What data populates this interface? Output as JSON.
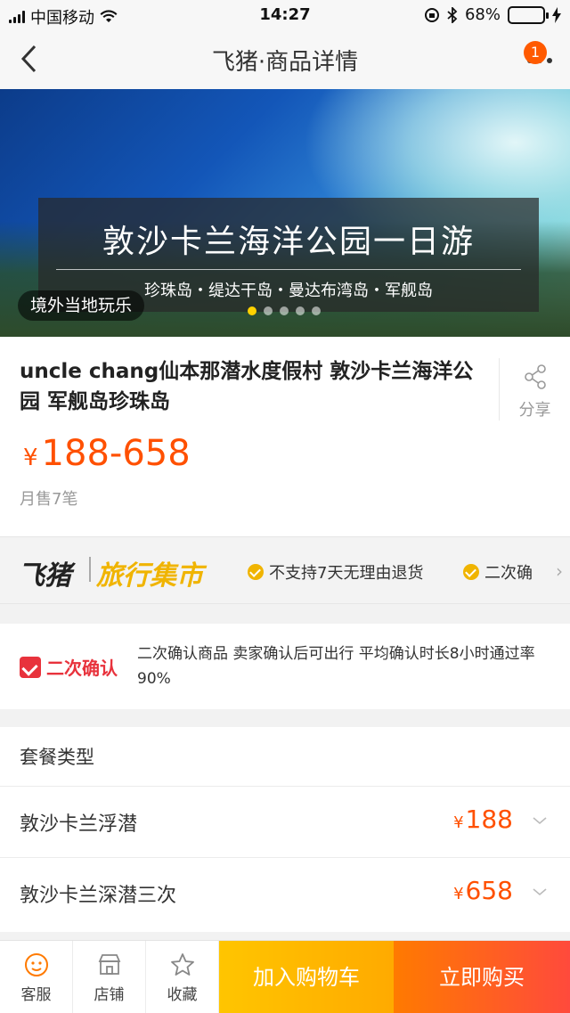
{
  "status_bar": {
    "carrier": "中国移动",
    "time": "14:27",
    "battery": "68%",
    "battery_level": 0.68
  },
  "nav": {
    "title": "飞猪·商品详情",
    "badge": "1"
  },
  "banner": {
    "title": "敦沙卡兰海洋公园一日游",
    "subtitle": "珍珠岛・缇达干岛・曼达布湾岛・军舰岛",
    "tag": "境外当地玩乐",
    "slide_count": 5,
    "active_slide": 1
  },
  "product": {
    "name": "uncle chang仙本那潜水度假村 敦沙卡兰海洋公园 军舰岛珍珠岛",
    "share_label": "分享",
    "currency": "¥",
    "price_range": "188-658",
    "sold": "月售7笔"
  },
  "market": {
    "logo_left": "飞猪",
    "logo_right": "旅行集市",
    "feature1": "不支持7天无理由退货",
    "feature2": "二次确"
  },
  "confirm": {
    "label": "二次确认",
    "text": "二次确认商品 卖家确认后可出行 平均确认时长8小时通过率90%"
  },
  "package": {
    "header": "套餐类型",
    "options": [
      {
        "name": "敦沙卡兰浮潜",
        "currency": "¥",
        "price": "188"
      },
      {
        "name": "敦沙卡兰深潜三次",
        "currency": "¥",
        "price": "658"
      }
    ]
  },
  "bottom_bar": {
    "service": "客服",
    "store": "店铺",
    "favorite": "收藏",
    "add_cart": "加入购物车",
    "buy_now": "立即购买"
  },
  "colors": {
    "price": "#ff5000",
    "accent_yellow": "#ffc500",
    "accent_orange": "#ff5a00"
  }
}
